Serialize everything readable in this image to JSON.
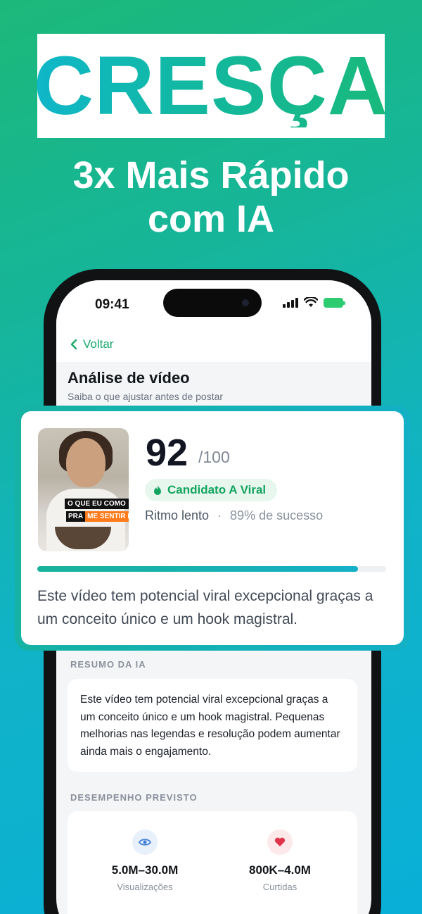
{
  "hero": {
    "title": "CRESÇA",
    "subtitle_line1": "3x Mais Rápido",
    "subtitle_line2": "com IA"
  },
  "status_bar": {
    "time": "09:41"
  },
  "nav": {
    "back_label": "Voltar"
  },
  "page": {
    "title": "Análise de vídeo",
    "subtitle": "Saiba o que ajustar antes de postar"
  },
  "score_card": {
    "score": "92",
    "score_max": "/100",
    "badge": "Candidato A Viral",
    "pace": "Ritmo lento",
    "separator": "·",
    "success": "89% de sucesso",
    "progress": 0.92,
    "description": "Este vídeo tem potencial viral excepcional graças a um conceito único e um hook magistral.",
    "thumbnail_caption_line1": "O QUE EU COMO",
    "thumbnail_caption_line2a": "PRA",
    "thumbnail_caption_line2b": "ME SENTIR BEM"
  },
  "ai_summary": {
    "label": "RESUMO DA IA",
    "text": "Este vídeo tem potencial viral excepcional graças a um conceito único e um hook magistral. Pequenas melhorias nas legendas e resolução podem aumentar ainda mais o engajamento."
  },
  "performance": {
    "label": "DESEMPENHO PREVISTO",
    "metrics": [
      {
        "value": "5.0M–30.0M",
        "label": "Visualizações",
        "icon": "eye-icon"
      },
      {
        "value": "800K–4.0M",
        "label": "Curtidas",
        "icon": "heart-icon"
      }
    ]
  },
  "colors": {
    "accent_green": "#17a86d",
    "gradient_start": "#1cb87a",
    "gradient_end": "#0aafd8"
  }
}
